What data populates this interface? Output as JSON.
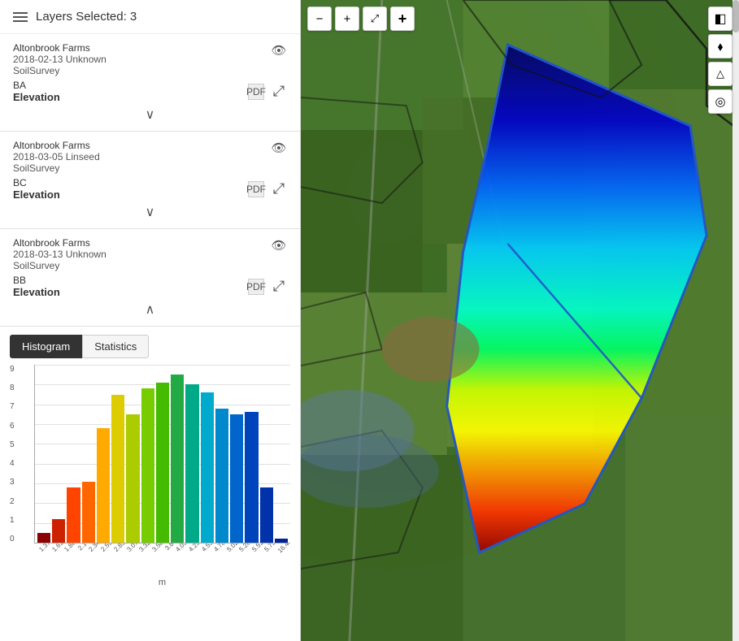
{
  "header": {
    "menu_icon_label": "menu",
    "title": "Layers Selected: 3"
  },
  "layers": [
    {
      "id": "layer-1",
      "farm_name": "Altonbrook Farms",
      "field_id": "BA",
      "date": "2018-02-13 Unknown",
      "survey_type": "SoilSurvey",
      "layer_label": "Elevation",
      "expanded": false
    },
    {
      "id": "layer-2",
      "farm_name": "Altonbrook Farms",
      "field_id": "BC",
      "date": "2018-03-05 Linseed",
      "survey_type": "SoilSurvey",
      "layer_label": "Elevation",
      "expanded": false
    },
    {
      "id": "layer-3",
      "farm_name": "Altonbrook Farms",
      "field_id": "BB",
      "date": "2018-03-13 Unknown",
      "survey_type": "SoilSurvey",
      "layer_label": "Elevation",
      "expanded": true
    }
  ],
  "tabs": {
    "histogram_label": "Histogram",
    "statistics_label": "Statistics",
    "active": "histogram"
  },
  "histogram": {
    "y_labels": [
      "0",
      "1",
      "2",
      "3",
      "4",
      "5",
      "6",
      "7",
      "8",
      "9"
    ],
    "x_unit": "m",
    "x_labels": [
      "1.37",
      "1.61",
      "1.86",
      "2.1",
      "2.34",
      "2.59",
      "2.83",
      "3.07",
      "3.32",
      "3.56",
      "3.8",
      "4.05",
      "4.29",
      "4.53",
      "4.78",
      "5.02",
      "5.26",
      "5.51",
      "5.75",
      "16.46"
    ],
    "bars": [
      {
        "value": 0.5,
        "color": "#8B0000"
      },
      {
        "value": 1.2,
        "color": "#CC2200"
      },
      {
        "value": 2.8,
        "color": "#FF4400"
      },
      {
        "value": 3.1,
        "color": "#FF6600"
      },
      {
        "value": 5.8,
        "color": "#FFAA00"
      },
      {
        "value": 7.5,
        "color": "#DDCC00"
      },
      {
        "value": 6.5,
        "color": "#AACC00"
      },
      {
        "value": 7.8,
        "color": "#77CC00"
      },
      {
        "value": 8.1,
        "color": "#44BB00"
      },
      {
        "value": 8.5,
        "color": "#22AA44"
      },
      {
        "value": 8.0,
        "color": "#00AA88"
      },
      {
        "value": 7.6,
        "color": "#00AACC"
      },
      {
        "value": 6.8,
        "color": "#0088CC"
      },
      {
        "value": 6.5,
        "color": "#0066CC"
      },
      {
        "value": 6.6,
        "color": "#0044BB"
      },
      {
        "value": 2.8,
        "color": "#0033AA"
      },
      {
        "value": 0.2,
        "color": "#002299"
      }
    ],
    "max_value": 9
  },
  "map_controls": {
    "zoom_out": "−",
    "zoom_in": "+",
    "fullscreen": "⤢",
    "layers_icon": "◧",
    "elevation_icon": "△",
    "location_icon": "◉"
  }
}
